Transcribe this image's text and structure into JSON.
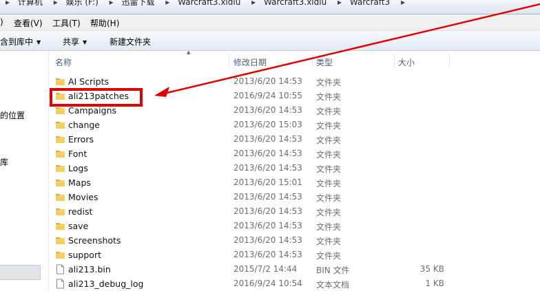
{
  "address_bar": {
    "crumbs": [
      "计算机",
      "娱乐 (F:)",
      "迅雷下载",
      "Warcraft3.xldiu",
      "Warcraft3.xldiu",
      "Warcraft3"
    ]
  },
  "menu": {
    "items": [
      "查看(V)",
      "工具(T)",
      "帮助(H)"
    ],
    "left_fragment": ")"
  },
  "toolbar": {
    "include_in_library": "含到库中",
    "share": "共享",
    "new_folder": "新建文件夹"
  },
  "nav_pane": {
    "items": [
      "的位置",
      "库"
    ]
  },
  "columns": {
    "name": "名称",
    "date_modified": "修改日期",
    "type": "类型",
    "size": "大小"
  },
  "files": [
    {
      "name": "AI Scripts",
      "date": "2013/6/20 14:53",
      "type": "文件夹",
      "size": "",
      "kind": "folder"
    },
    {
      "name": "ali213patches",
      "date": "2016/9/24 10:55",
      "type": "文件夹",
      "size": "",
      "kind": "folder"
    },
    {
      "name": "Campaigns",
      "date": "2013/6/20 14:53",
      "type": "文件夹",
      "size": "",
      "kind": "folder"
    },
    {
      "name": "change",
      "date": "2013/6/20 15:03",
      "type": "文件夹",
      "size": "",
      "kind": "folder"
    },
    {
      "name": "Errors",
      "date": "2013/6/20 14:53",
      "type": "文件夹",
      "size": "",
      "kind": "folder"
    },
    {
      "name": "Font",
      "date": "2013/6/20 14:53",
      "type": "文件夹",
      "size": "",
      "kind": "folder"
    },
    {
      "name": "Logs",
      "date": "2013/6/20 14:53",
      "type": "文件夹",
      "size": "",
      "kind": "folder"
    },
    {
      "name": "Maps",
      "date": "2013/6/20 15:01",
      "type": "文件夹",
      "size": "",
      "kind": "folder"
    },
    {
      "name": "Movies",
      "date": "2013/6/20 14:53",
      "type": "文件夹",
      "size": "",
      "kind": "folder"
    },
    {
      "name": "redist",
      "date": "2013/6/20 14:53",
      "type": "文件夹",
      "size": "",
      "kind": "folder"
    },
    {
      "name": "save",
      "date": "2013/6/20 14:53",
      "type": "文件夹",
      "size": "",
      "kind": "folder"
    },
    {
      "name": "Screenshots",
      "date": "2013/6/20 14:53",
      "type": "文件夹",
      "size": "",
      "kind": "folder"
    },
    {
      "name": "support",
      "date": "2013/6/20 14:53",
      "type": "文件夹",
      "size": "",
      "kind": "folder"
    },
    {
      "name": "ali213.bin",
      "date": "2015/7/2 14:44",
      "type": "BIN 文件",
      "size": "35 KB",
      "kind": "file"
    },
    {
      "name": "ali213_debug_log",
      "date": "2016/9/24 10:54",
      "type": "文本文档",
      "size": "1 KB",
      "kind": "file"
    }
  ],
  "annotation": {
    "color": "#e00000",
    "highlighted_item": "ali213patches"
  },
  "colors": {
    "folder": "#f1c64c",
    "header_text": "#4c607a",
    "detail_text": "#6d6d6d"
  }
}
